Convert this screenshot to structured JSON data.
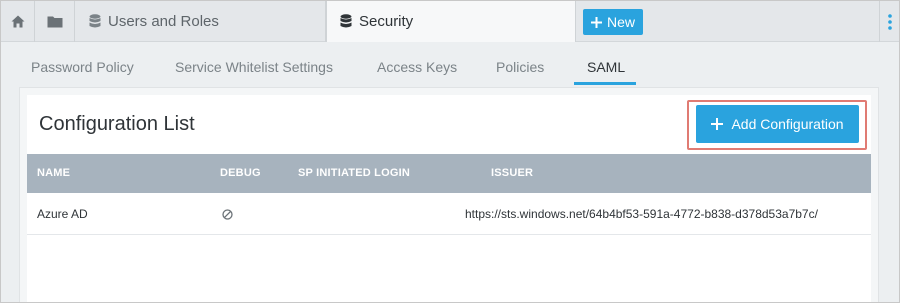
{
  "tabs": {
    "users": "Users and Roles",
    "security": "Security",
    "new": "New"
  },
  "subtabs": [
    "Password Policy",
    "Service Whitelist Settings",
    "Access Keys",
    "Policies",
    "SAML"
  ],
  "panel": {
    "title": "Configuration List",
    "add_button": "Add Configuration"
  },
  "table": {
    "columns": [
      "NAME",
      "DEBUG",
      "SP INITIATED LOGIN",
      "ISSUER"
    ],
    "rows": [
      {
        "name": "Azure AD",
        "debug_icon": "disabled-icon",
        "sp_initiated_login": "",
        "issuer": "https://sts.windows.net/64b4bf53-591a-4772-b838-d378d53a7b7c/"
      }
    ]
  },
  "colors": {
    "accent": "#2aa3de",
    "header": "#a7b3be",
    "highlight": "#e07b73"
  }
}
